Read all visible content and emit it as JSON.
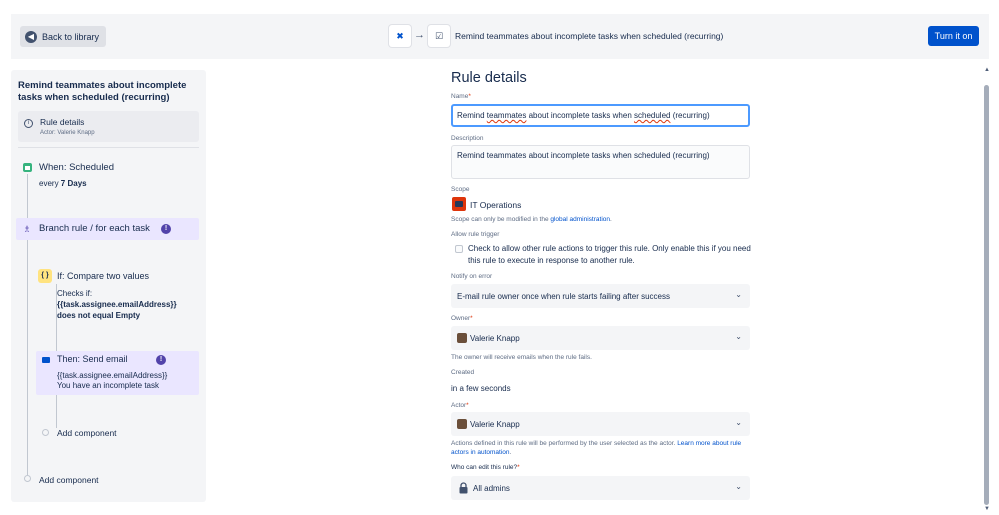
{
  "topbar": {
    "back_label": "Back to library",
    "arrow": "→",
    "title": "Remind teammates about incomplete tasks when scheduled (recurring)",
    "turn_on_label": "Turn it on",
    "icons": [
      "scheduled-trigger-icon",
      "task-icon"
    ]
  },
  "left": {
    "title": "Remind teammates about incomplete tasks when scheduled (recurring)",
    "rule_details": {
      "label": "Rule details",
      "actor": "Actor: Valerie Knapp"
    },
    "when": {
      "title": "When: Scheduled",
      "prefix": "every ",
      "interval": "7 Days"
    },
    "branch": {
      "title": "Branch rule / for each task",
      "badge": "!"
    },
    "if": {
      "icon_text": "{ }",
      "title": "If: Compare two values",
      "line1": "Checks if:",
      "line2": "{{task.assignee.emailAddress}}",
      "line3": "does not equal Empty"
    },
    "then": {
      "title": "Then: Send email",
      "badge": "!",
      "line1": "{{task.assignee.emailAddress}}",
      "line2": "You have an incomplete task"
    },
    "add_component_inner": "Add component",
    "add_component_outer": "Add component"
  },
  "form": {
    "heading": "Rule details",
    "name_label": "Name",
    "required": "*",
    "name_parts": [
      "Remind ",
      "teammates",
      " about incomplete tasks when ",
      "scheduled",
      " (recurring)"
    ],
    "description_label": "Description",
    "description_value": "Remind teammates about incomplete tasks when scheduled (recurring)",
    "scope_label": "Scope",
    "scope_value": "IT Operations",
    "scope_help_prefix": "Scope can only be modified in the ",
    "scope_help_link": "global administration",
    "scope_help_suffix": ".",
    "allow_trigger_label": "Allow rule trigger",
    "allow_trigger_text": "Check to allow other rule actions to trigger this rule. Only enable this if you need this rule to execute in response to another rule.",
    "notify_label": "Notify on error",
    "notify_value": "E-mail rule owner once when rule starts failing after success",
    "owner_label": "Owner",
    "owner_value": "Valerie Knapp",
    "owner_help": "The owner will receive emails when the rule fails.",
    "created_label": "Created",
    "created_value": "in a few seconds",
    "actor_label": "Actor",
    "actor_value": "Valerie Knapp",
    "actor_help_prefix": "Actions defined in this rule will be performed by the user selected as the actor. ",
    "actor_help_link": "Learn more about rule actors in automation",
    "actor_help_suffix": ".",
    "who_edit_label": "Who can edit this rule?",
    "who_edit_value": "All admins",
    "chevron": "⌄"
  },
  "colors": {
    "accent": "#0052cc",
    "purple": "#5243aa",
    "panel": "#f4f5f7",
    "required": "#de350b"
  }
}
